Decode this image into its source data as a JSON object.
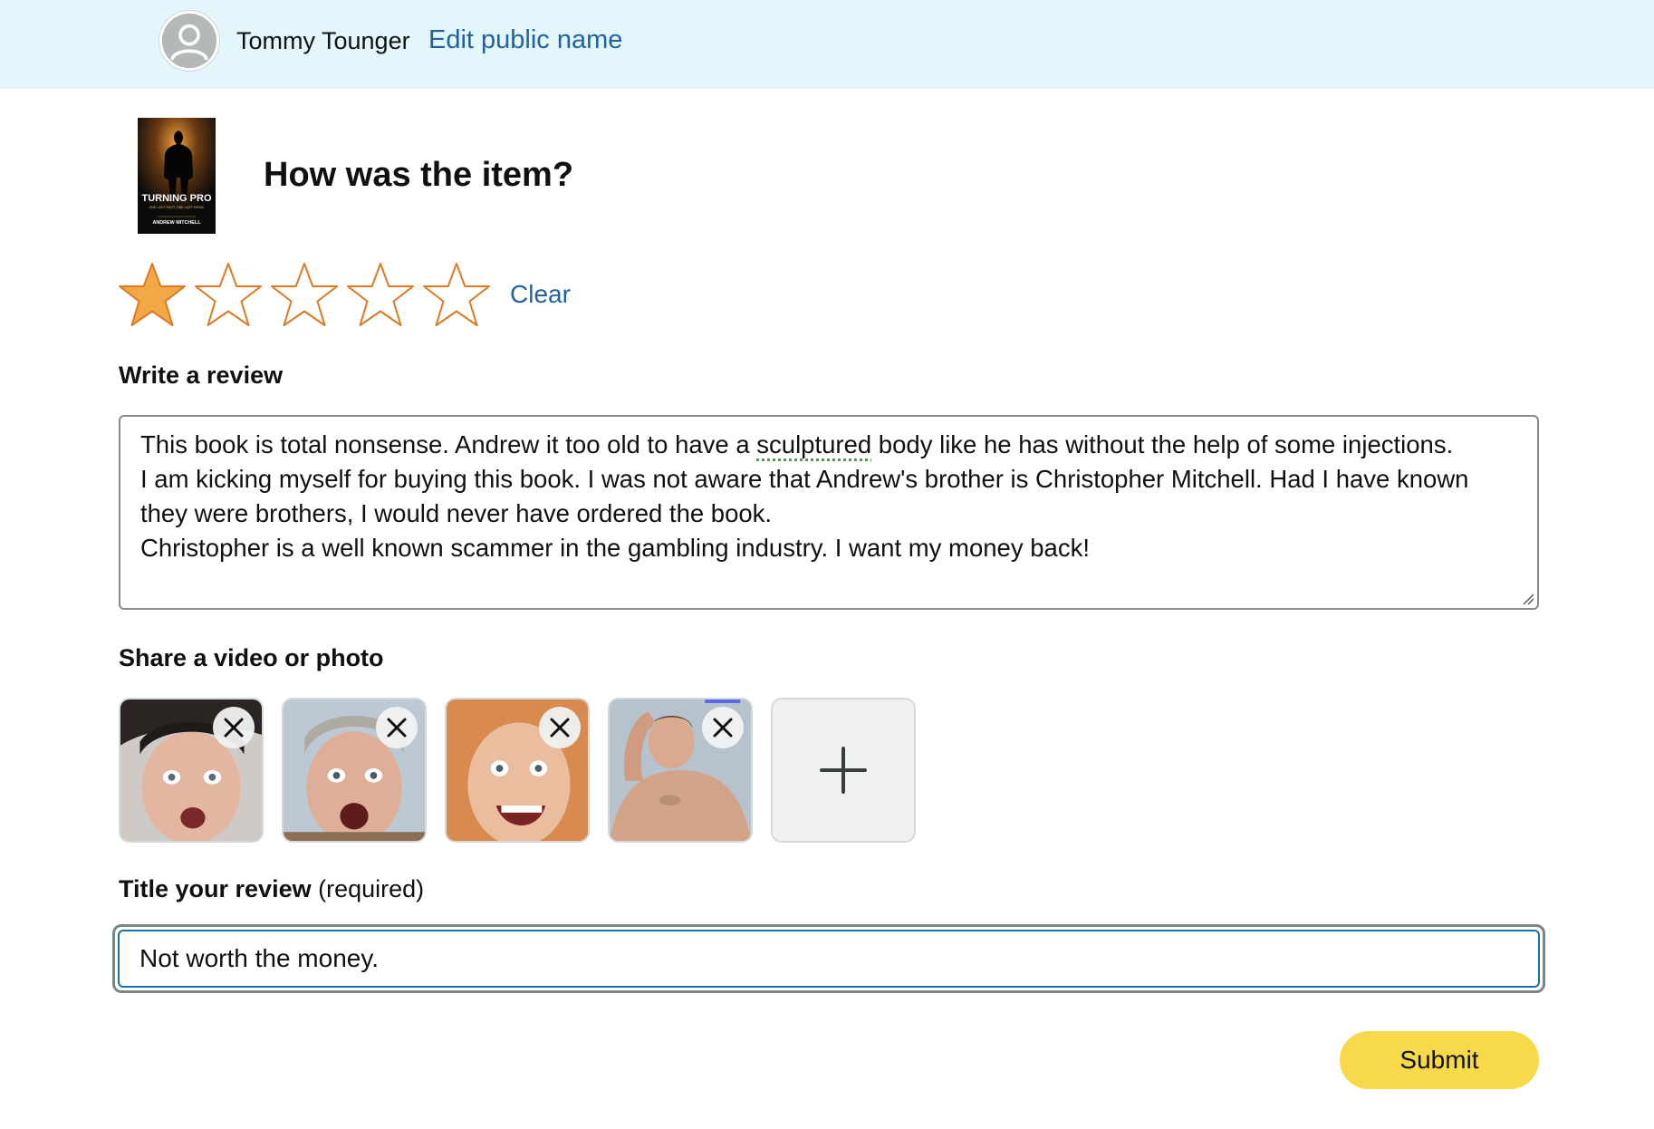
{
  "header": {
    "user_name": "Tommy Tounger",
    "edit_link": "Edit public name"
  },
  "product": {
    "question": "How was the item?",
    "cover_title": "TURNING PRO",
    "cover_subtitle": "ONE LAST SHOT. ONE LAST SHOW.",
    "cover_author": "ANDREW MITCHELL"
  },
  "rating": {
    "selected": 1,
    "max": 5,
    "clear_label": "Clear",
    "filled_color": "#f3a847",
    "outline_color": "#de7921"
  },
  "review": {
    "label": "Write a review",
    "text_before_flag": "This book is total nonsense. Andrew it too old to have a ",
    "flagged_word": "sculptured",
    "text_after_flag": " body like he has without the help of some injections.\nI am kicking myself for buying this book. I was not aware that Andrew's brother is Christopher Mitchell. Had I have known they were brothers, I would never have ordered the book.\nChristopher is a well known scammer in the gambling industry. I want my money back!"
  },
  "media": {
    "label": "Share a video or photo",
    "photos": [
      {
        "icon": "photo-thumbnail-icon",
        "remove_icon": "close-icon"
      },
      {
        "icon": "photo-thumbnail-icon",
        "remove_icon": "close-icon"
      },
      {
        "icon": "photo-thumbnail-icon",
        "remove_icon": "close-icon"
      },
      {
        "icon": "photo-thumbnail-icon",
        "remove_icon": "close-icon"
      }
    ],
    "add_icon": "plus-icon"
  },
  "title_field": {
    "label": "Title your review",
    "required_note": "(required)",
    "value": "Not worth the money."
  },
  "submit": {
    "label": "Submit",
    "color": "#f7d94a"
  }
}
